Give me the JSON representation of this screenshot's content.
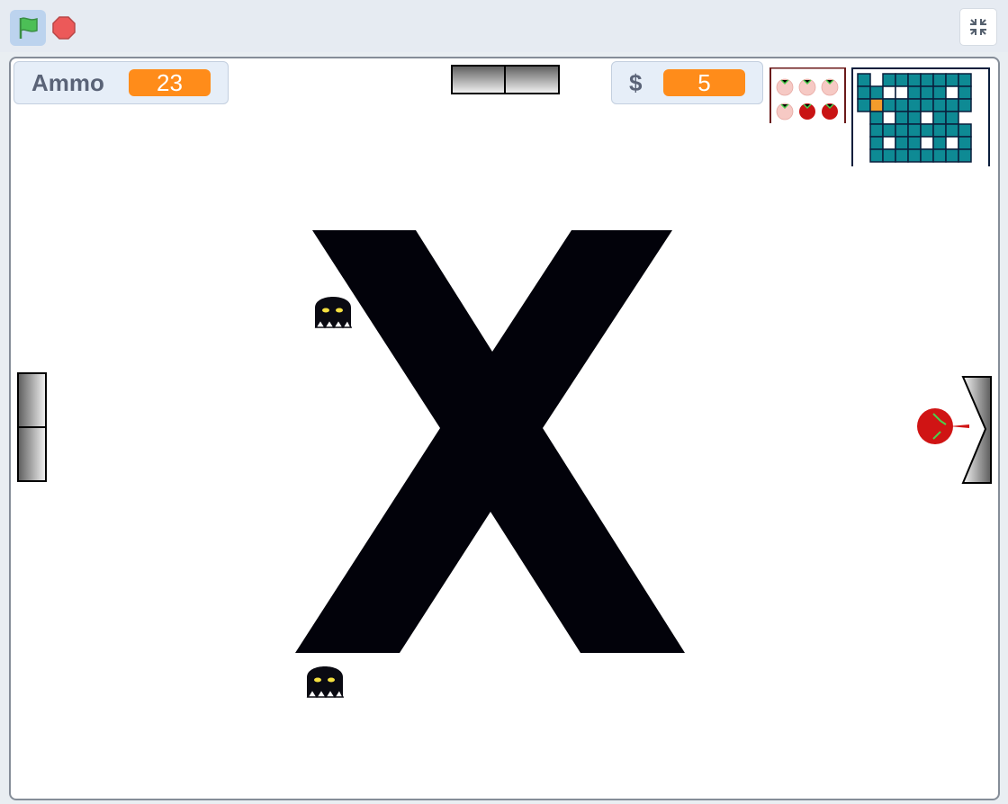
{
  "toolbar": {
    "green_flag_icon": "green-flag-icon",
    "stop_icon": "stop-sign-icon",
    "fullscreen_icon": "exit-fullscreen-icon"
  },
  "monitors": {
    "ammo": {
      "label": "Ammo",
      "value": "23"
    },
    "money": {
      "label": "$",
      "value": "5"
    }
  },
  "stage": {
    "center_sprite_icon": "x-mark",
    "enemies": [
      "hooded-ghost-enemy",
      "hooded-ghost-enemy"
    ],
    "player": "red-tomato-player",
    "doors": [
      "top-door",
      "left-door",
      "right-door"
    ]
  },
  "colors": {
    "accent_orange": "#ff8c1a",
    "flag_green": "#4cbf56",
    "stop_red": "#ec5959",
    "minimap_teal": "#0e8a94",
    "minimap_current_room": "#f39c2b",
    "tomato_red": "#d01414"
  },
  "lives": {
    "total": 6,
    "active": 2
  }
}
